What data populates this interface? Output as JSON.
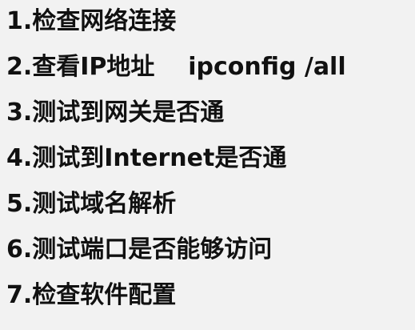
{
  "steps": [
    "1.检查网络连接",
    "2.查看IP地址    ipconfig /all",
    "3.测试到网关是否通",
    "4.测试到Internet是否通",
    "5.测试域名解析",
    "6.测试端口是否能够访问",
    "7.检查软件配置"
  ]
}
